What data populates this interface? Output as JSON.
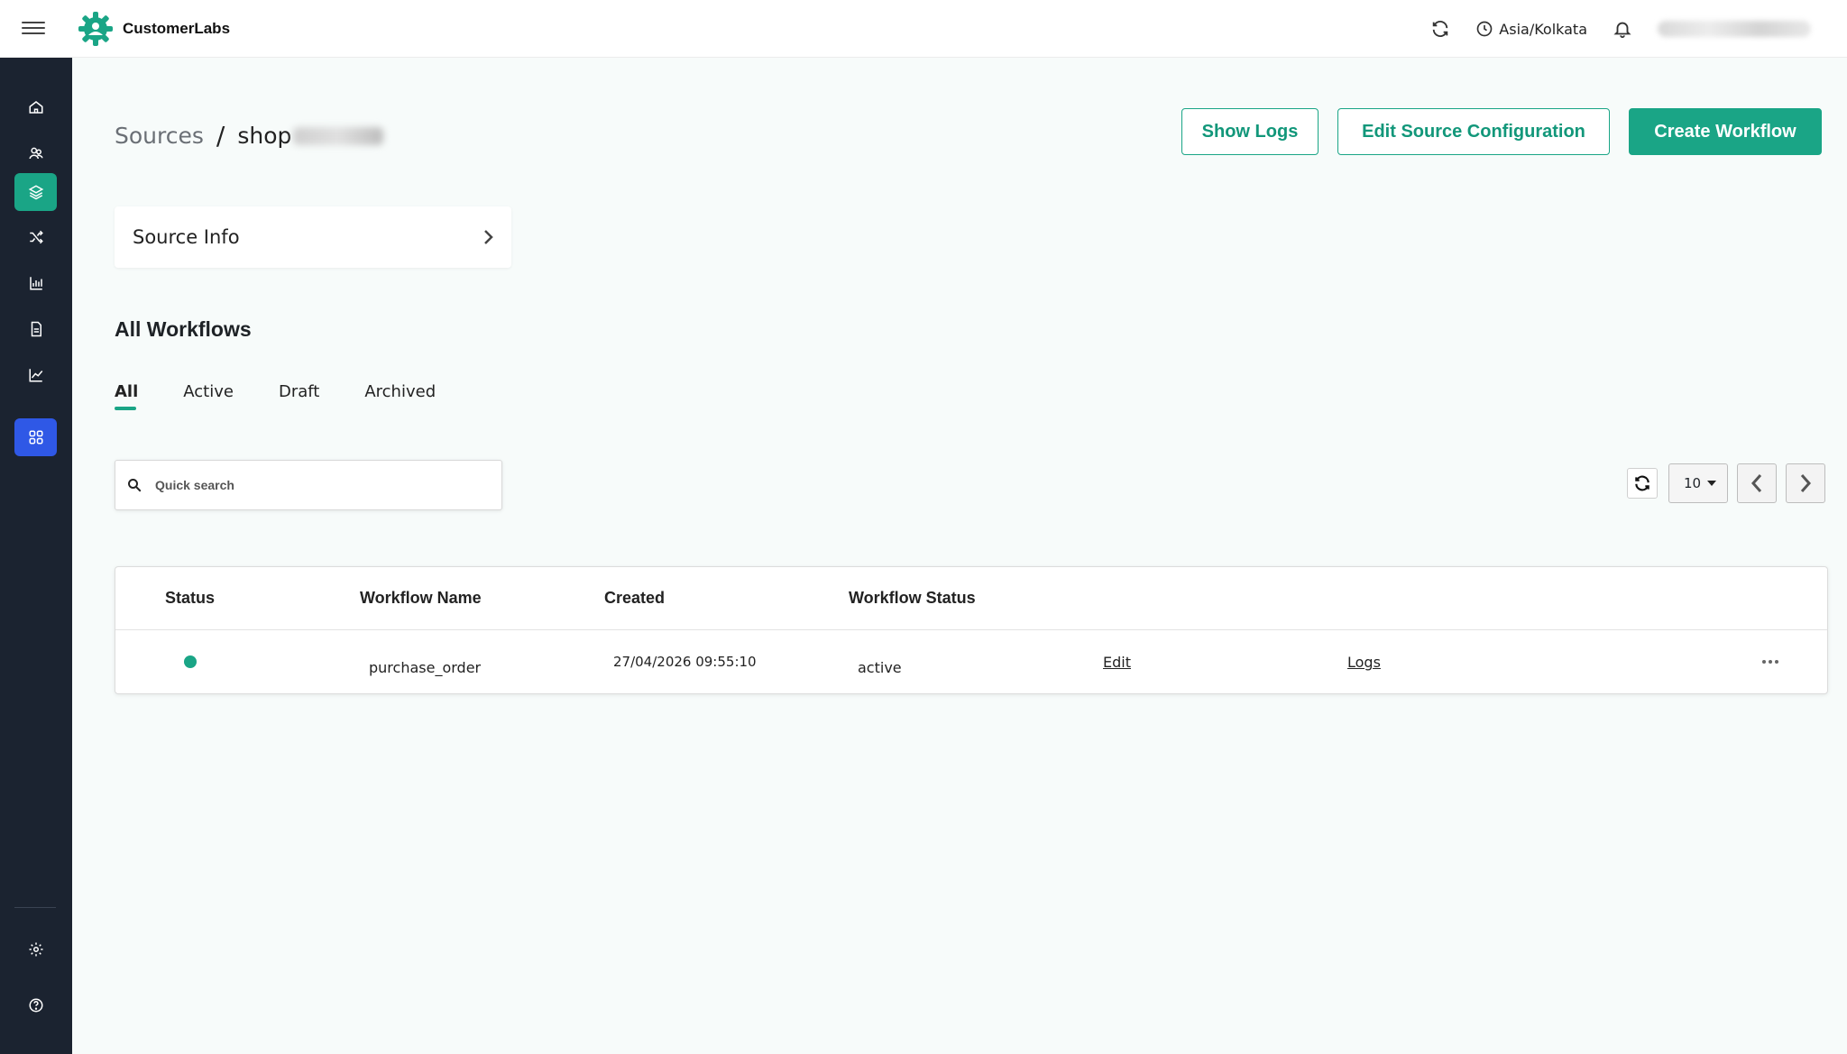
{
  "app": {
    "brand_name": "CustomerLabs"
  },
  "header": {
    "timezone": "Asia/Kolkata"
  },
  "sidebar": {
    "items": [
      {
        "name": "home-icon"
      },
      {
        "name": "users-icon"
      },
      {
        "name": "layers-icon",
        "active": true
      },
      {
        "name": "shuffle-icon"
      },
      {
        "name": "bar-chart-icon"
      },
      {
        "name": "document-icon"
      },
      {
        "name": "line-chart-icon"
      },
      {
        "name": "apps-grid-icon"
      },
      {
        "name": "gear-icon"
      },
      {
        "name": "help-icon"
      }
    ]
  },
  "breadcrumb": {
    "root": "Sources",
    "separator": "/",
    "current": "shop"
  },
  "actions": {
    "show_logs": "Show Logs",
    "edit_source_config": "Edit Source Configuration",
    "create_workflow": "Create Workflow"
  },
  "source_info": {
    "label": "Source Info"
  },
  "workflows": {
    "title": "All Workflows",
    "tabs": [
      "All",
      "Active",
      "Draft",
      "Archived"
    ],
    "active_tab": "All",
    "search": {
      "placeholder": "Quick search",
      "value": ""
    },
    "pagination": {
      "page_size": "10"
    },
    "columns": [
      "Status",
      "Workflow Name",
      "Created",
      "Workflow Status"
    ],
    "rows": [
      {
        "status_color": "#1aa586",
        "name": "purchase_order",
        "created": "27/04/2026 09:55:10",
        "workflow_status": "active",
        "edit_label": "Edit",
        "logs_label": "Logs"
      }
    ]
  },
  "colors": {
    "accent": "#1aa586",
    "sidebar_bg": "#1b2330",
    "apps_blue": "#2f58e6"
  }
}
